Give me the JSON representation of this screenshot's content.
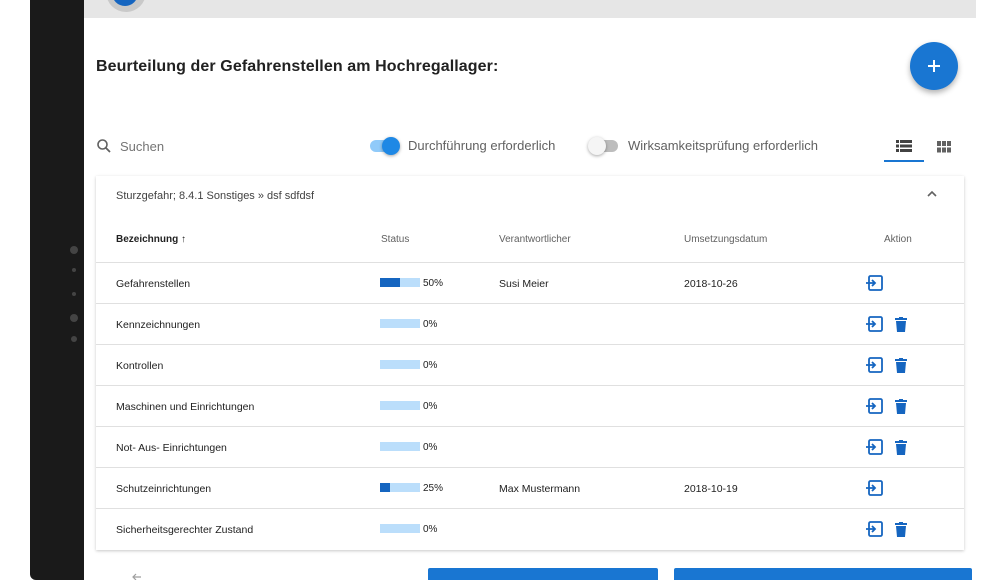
{
  "page": {
    "title": "Beurteilung der Gefahrenstellen am Hochregallager:"
  },
  "search": {
    "placeholder": "Suchen"
  },
  "filters": {
    "toggle1": {
      "label": "Durchführung erforderlich",
      "state": "on"
    },
    "toggle2": {
      "label": "Wirksamkeitsprüfung erforderlich",
      "state": "off"
    }
  },
  "view": {
    "active": "list",
    "modes": [
      "list-icon",
      "grid-icon"
    ]
  },
  "group": {
    "header": "Sturzgefahr; 8.4.1 Sonstiges » dsf sdfdsf"
  },
  "table": {
    "columns": {
      "name": "Bezeichnung ↑",
      "status": "Status",
      "owner": "Verantwortlicher",
      "date": "Umsetzungsdatum",
      "action": "Aktion"
    },
    "rows": [
      {
        "name": "Gefahrenstellen",
        "progress": 50,
        "pct": "50%",
        "owner": "Susi Meier",
        "date": "2018-10-26",
        "deletable": false
      },
      {
        "name": "Kennzeichnungen",
        "progress": 0,
        "pct": "0%",
        "owner": "",
        "date": "",
        "deletable": true
      },
      {
        "name": "Kontrollen",
        "progress": 0,
        "pct": "0%",
        "owner": "",
        "date": "",
        "deletable": true
      },
      {
        "name": "Maschinen und Einrichtungen",
        "progress": 0,
        "pct": "0%",
        "owner": "",
        "date": "",
        "deletable": true
      },
      {
        "name": "Not- Aus- Einrichtungen",
        "progress": 0,
        "pct": "0%",
        "owner": "",
        "date": "",
        "deletable": true
      },
      {
        "name": "Schutzeinrichtungen",
        "progress": 25,
        "pct": "25%",
        "owner": "Max Mustermann",
        "date": "2018-10-19",
        "deletable": false
      },
      {
        "name": "Sicherheitsgerechter Zustand",
        "progress": 0,
        "pct": "0%",
        "owner": "",
        "date": "",
        "deletable": true
      }
    ]
  },
  "colors": {
    "accent": "#1976d2",
    "progress_track": "#bbdefb",
    "progress_fill": "#1565c0"
  }
}
